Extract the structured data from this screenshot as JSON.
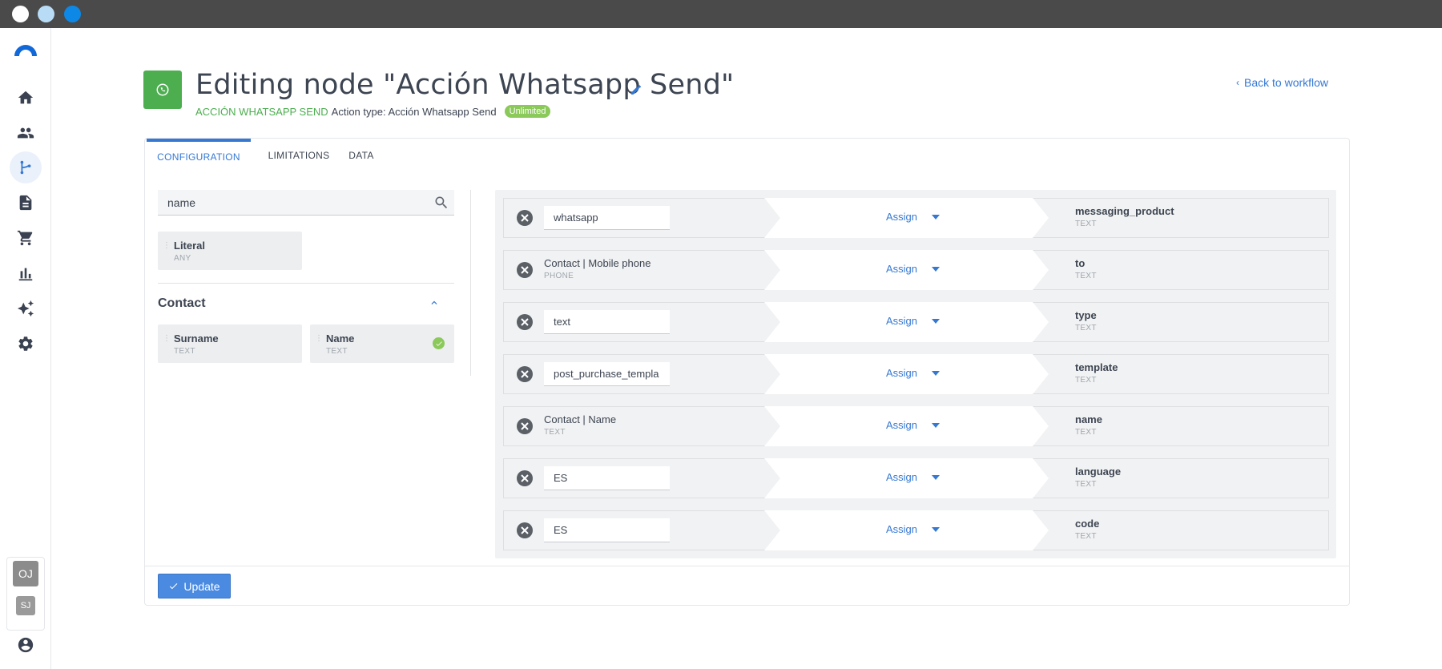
{
  "window": {
    "dots": [
      "close",
      "minimize",
      "maximize"
    ]
  },
  "sidebar": {
    "items": [
      {
        "icon": "home-icon",
        "active": false
      },
      {
        "icon": "people-icon",
        "active": false
      },
      {
        "icon": "workflow-icon",
        "active": true
      },
      {
        "icon": "document-icon",
        "active": false
      },
      {
        "icon": "cart-icon",
        "active": false
      },
      {
        "icon": "bar-chart-icon",
        "active": false
      },
      {
        "icon": "sparkles-icon",
        "active": false
      },
      {
        "icon": "gear-icon",
        "active": false
      }
    ],
    "avatars": [
      "OJ",
      "SJ"
    ],
    "account_icon": "account-circle-icon"
  },
  "header": {
    "title": "Editing node \"Acción Whatsapp Send\"",
    "node_type": "ACCIÓN WHATSAPP SEND",
    "action_type": "Action type: Acción Whatsapp Send",
    "badge": "Unlimited",
    "back_link": "Back to workflow",
    "accent_color": "#4cae4f"
  },
  "tabs": [
    {
      "label": "CONFIGURATION",
      "active": true
    },
    {
      "label": "LIMITATIONS",
      "active": false
    },
    {
      "label": "DATA",
      "active": false
    }
  ],
  "fields_panel": {
    "search_value": "name",
    "literal": {
      "name": "Literal",
      "type": "ANY"
    },
    "group": {
      "title": "Contact",
      "fields": [
        {
          "name": "Surname",
          "type": "TEXT",
          "selected": false
        },
        {
          "name": "Name",
          "type": "TEXT",
          "selected": true
        }
      ]
    }
  },
  "mappings": [
    {
      "source_kind": "literal",
      "source_value": "whatsapp",
      "action": "Assign",
      "target": "messaging_product",
      "target_type": "TEXT"
    },
    {
      "source_kind": "field",
      "source_value": "Contact | Mobile phone",
      "source_type": "PHONE",
      "action": "Assign",
      "target": "to",
      "target_type": "TEXT"
    },
    {
      "source_kind": "literal",
      "source_value": "text",
      "action": "Assign",
      "target": "type",
      "target_type": "TEXT"
    },
    {
      "source_kind": "literal",
      "source_value": "post_purchase_templa",
      "action": "Assign",
      "target": "template",
      "target_type": "TEXT"
    },
    {
      "source_kind": "field",
      "source_value": "Contact | Name",
      "source_type": "TEXT",
      "action": "Assign",
      "target": "name",
      "target_type": "TEXT"
    },
    {
      "source_kind": "literal",
      "source_value": "ES",
      "action": "Assign",
      "target": "language",
      "target_type": "TEXT"
    },
    {
      "source_kind": "literal",
      "source_value": "ES",
      "action": "Assign",
      "target": "code",
      "target_type": "TEXT"
    }
  ],
  "footer": {
    "update_label": "Update"
  },
  "colors": {
    "primary": "#3578d3",
    "success": "#8bc95a",
    "chrome": "#4a4a4a"
  }
}
